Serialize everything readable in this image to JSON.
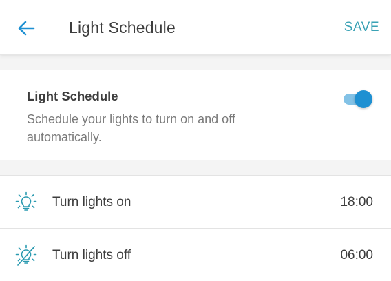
{
  "colors": {
    "accent": "#1e90d2",
    "save_text": "#3aa2b5",
    "icon_teal": "#2a9ab0"
  },
  "header": {
    "back_icon": "arrow-left-icon",
    "title": "Light Schedule",
    "save_label": "SAVE"
  },
  "schedule_card": {
    "title": "Light Schedule",
    "description": "Schedule your lights to turn on and off automatically.",
    "toggle_on": true
  },
  "rows": [
    {
      "icon": "lightbulb-on-icon",
      "label": "Turn lights on",
      "value": "18:00"
    },
    {
      "icon": "lightbulb-off-icon",
      "label": "Turn lights off",
      "value": "06:00"
    }
  ]
}
